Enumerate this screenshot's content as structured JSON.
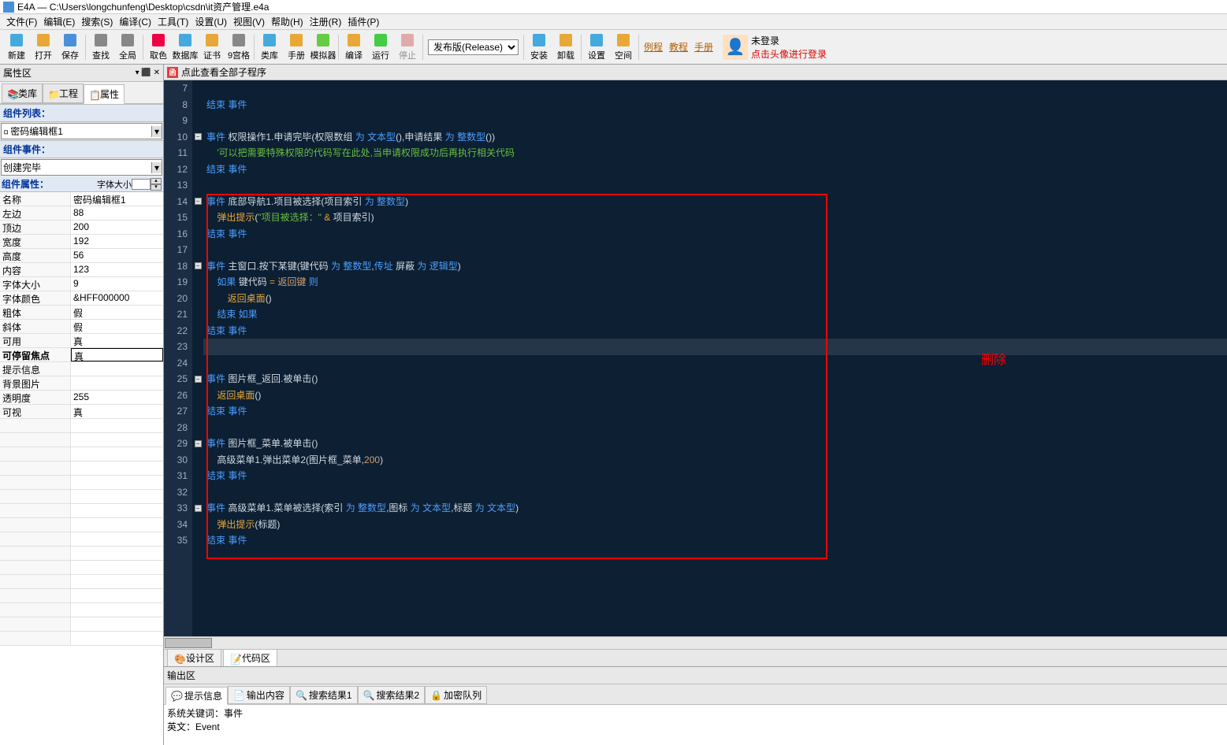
{
  "title": "E4A — C:\\Users\\longchunfeng\\Desktop\\csdn\\it资产管理.e4a",
  "menu": [
    "文件(F)",
    "编辑(E)",
    "搜索(S)",
    "编译(C)",
    "工具(T)",
    "设置(U)",
    "视图(V)",
    "帮助(H)",
    "注册(R)",
    "插件(P)"
  ],
  "toolbar": {
    "groups": [
      [
        "新建",
        "打开",
        "保存"
      ],
      [
        "查找",
        "全局"
      ],
      [
        "取色",
        "数据库",
        "证书",
        "9宫格"
      ],
      [
        "类库",
        "手册",
        "模拟器"
      ],
      [
        "编译",
        "运行",
        "停止"
      ]
    ],
    "release_combo": "发布版(Release)",
    "group2": [
      "安装",
      "卸载"
    ],
    "group3": [
      "设置",
      "空间"
    ],
    "links": [
      "例程",
      "教程",
      "手册"
    ],
    "login_top": "未登录",
    "login_bottom": "点击头像进行登录"
  },
  "left": {
    "header": "属性区",
    "tabs": [
      {
        "label": "类库",
        "active": false
      },
      {
        "label": "工程",
        "active": false
      },
      {
        "label": "属性",
        "active": true
      }
    ],
    "comp_list_hdr": "组件列表：",
    "comp_combo": "密码编辑框1",
    "comp_evt_hdr": "组件事件：",
    "evt_combo": "创建完毕",
    "comp_prop_hdr": "组件属性：",
    "font_size_label": "字体大小",
    "font_size_val": "",
    "props": [
      {
        "name": "名称",
        "val": "密码编辑框1",
        "sel": false
      },
      {
        "name": "左边",
        "val": "88",
        "sel": false
      },
      {
        "name": "顶边",
        "val": "200",
        "sel": false
      },
      {
        "name": "宽度",
        "val": "192",
        "sel": false
      },
      {
        "name": "高度",
        "val": "56",
        "sel": false
      },
      {
        "name": "内容",
        "val": "123",
        "sel": false
      },
      {
        "name": "字体大小",
        "val": "9",
        "sel": false
      },
      {
        "name": "字体颜色",
        "val": "&HFF000000",
        "sel": false
      },
      {
        "name": "粗体",
        "val": "假",
        "sel": false
      },
      {
        "name": "斜体",
        "val": "假",
        "sel": false
      },
      {
        "name": "可用",
        "val": "真",
        "sel": false
      },
      {
        "name": "可停留焦点",
        "val": "真",
        "sel": true,
        "bold": true
      },
      {
        "name": "提示信息",
        "val": "",
        "sel": false
      },
      {
        "name": "背景图片",
        "val": "",
        "sel": false
      },
      {
        "name": "透明度",
        "val": "255",
        "sel": false
      },
      {
        "name": "可视",
        "val": "真",
        "sel": false
      }
    ]
  },
  "editor": {
    "tab_label": "点此查看全部子程序",
    "delete_label": "删除",
    "lines": [
      {
        "n": 7,
        "fold": "",
        "tokens": []
      },
      {
        "n": 8,
        "fold": "",
        "tokens": [
          {
            "c": "kw",
            "t": "结束 事件"
          }
        ]
      },
      {
        "n": 9,
        "fold": "",
        "tokens": []
      },
      {
        "n": 10,
        "fold": "-",
        "tokens": [
          {
            "c": "kw",
            "t": "事件 "
          },
          {
            "c": "ident",
            "t": "权限操作1.申请完毕"
          },
          {
            "c": "ident",
            "t": "(权限数组 "
          },
          {
            "c": "kw",
            "t": "为 "
          },
          {
            "c": "type",
            "t": "文本型"
          },
          {
            "c": "ident",
            "t": "(),申请结果 "
          },
          {
            "c": "kw",
            "t": "为 "
          },
          {
            "c": "type",
            "t": "整数型"
          },
          {
            "c": "ident",
            "t": "())"
          }
        ]
      },
      {
        "n": 11,
        "fold": "",
        "tokens": [
          {
            "c": "ident",
            "t": "    "
          },
          {
            "c": "comment",
            "t": "'可以把需要特殊权限的代码写在此处,当申请权限成功后再执行相关代码"
          }
        ]
      },
      {
        "n": 12,
        "fold": "",
        "tokens": [
          {
            "c": "kw",
            "t": "结束 事件"
          }
        ]
      },
      {
        "n": 13,
        "fold": "",
        "tokens": []
      },
      {
        "n": 14,
        "fold": "-",
        "tokens": [
          {
            "c": "kw",
            "t": "事件 "
          },
          {
            "c": "ident",
            "t": "底部导航1.项目被选择"
          },
          {
            "c": "ident",
            "t": "(项目索引 "
          },
          {
            "c": "kw",
            "t": "为 "
          },
          {
            "c": "type",
            "t": "整数型"
          },
          {
            "c": "ident",
            "t": ")"
          }
        ]
      },
      {
        "n": 15,
        "fold": "",
        "tokens": [
          {
            "c": "ident",
            "t": "    "
          },
          {
            "c": "func",
            "t": "弹出提示"
          },
          {
            "c": "ident",
            "t": "("
          },
          {
            "c": "str",
            "t": "\"项目被选择：\""
          },
          {
            "c": "ident",
            "t": " "
          },
          {
            "c": "const",
            "t": "&"
          },
          {
            "c": "ident",
            "t": " 项目索引)"
          }
        ]
      },
      {
        "n": 16,
        "fold": "",
        "tokens": [
          {
            "c": "kw",
            "t": "结束 事件"
          }
        ]
      },
      {
        "n": 17,
        "fold": "",
        "tokens": []
      },
      {
        "n": 18,
        "fold": "-",
        "tokens": [
          {
            "c": "kw",
            "t": "事件 "
          },
          {
            "c": "ident",
            "t": "主窗口.按下某键"
          },
          {
            "c": "ident",
            "t": "(键代码 "
          },
          {
            "c": "kw",
            "t": "为 "
          },
          {
            "c": "type",
            "t": "整数型"
          },
          {
            "c": "ident",
            "t": ","
          },
          {
            "c": "kw",
            "t": "传址 "
          },
          {
            "c": "ident",
            "t": "屏蔽 "
          },
          {
            "c": "kw",
            "t": "为 "
          },
          {
            "c": "type",
            "t": "逻辑型"
          },
          {
            "c": "ident",
            "t": ")"
          }
        ]
      },
      {
        "n": 19,
        "fold": "",
        "tokens": [
          {
            "c": "ident",
            "t": "    "
          },
          {
            "c": "kw",
            "t": "如果 "
          },
          {
            "c": "ident",
            "t": "键代码 "
          },
          {
            "c": "const",
            "t": "="
          },
          {
            "c": "ident",
            "t": " "
          },
          {
            "c": "num",
            "t": "返回键"
          },
          {
            "c": "ident",
            "t": " "
          },
          {
            "c": "kw",
            "t": "则"
          }
        ]
      },
      {
        "n": 20,
        "fold": "",
        "tokens": [
          {
            "c": "ident",
            "t": "        "
          },
          {
            "c": "func",
            "t": "返回桌面"
          },
          {
            "c": "ident",
            "t": "()"
          }
        ]
      },
      {
        "n": 21,
        "fold": "",
        "tokens": [
          {
            "c": "ident",
            "t": "    "
          },
          {
            "c": "kw",
            "t": "结束 如果"
          }
        ]
      },
      {
        "n": 22,
        "fold": "",
        "tokens": [
          {
            "c": "kw",
            "t": "结束 事件"
          }
        ]
      },
      {
        "n": 23,
        "fold": "",
        "hl": true,
        "tokens": []
      },
      {
        "n": 24,
        "fold": "",
        "tokens": []
      },
      {
        "n": 25,
        "fold": "-",
        "tokens": [
          {
            "c": "kw",
            "t": "事件 "
          },
          {
            "c": "ident",
            "t": "图片框_返回.被单击"
          },
          {
            "c": "ident",
            "t": "()"
          }
        ]
      },
      {
        "n": 26,
        "fold": "",
        "tokens": [
          {
            "c": "ident",
            "t": "    "
          },
          {
            "c": "func",
            "t": "返回桌面"
          },
          {
            "c": "ident",
            "t": "()"
          }
        ]
      },
      {
        "n": 27,
        "fold": "",
        "tokens": [
          {
            "c": "kw",
            "t": "结束 事件"
          }
        ]
      },
      {
        "n": 28,
        "fold": "",
        "tokens": []
      },
      {
        "n": 29,
        "fold": "-",
        "tokens": [
          {
            "c": "kw",
            "t": "事件 "
          },
          {
            "c": "ident",
            "t": "图片框_菜单.被单击"
          },
          {
            "c": "ident",
            "t": "()"
          }
        ]
      },
      {
        "n": 30,
        "fold": "",
        "tokens": [
          {
            "c": "ident",
            "t": "    高级菜单1.弹出菜单2(图片框_菜单,"
          },
          {
            "c": "num",
            "t": "200"
          },
          {
            "c": "ident",
            "t": ")"
          }
        ]
      },
      {
        "n": 31,
        "fold": "",
        "tokens": [
          {
            "c": "kw",
            "t": "结束 事件"
          }
        ]
      },
      {
        "n": 32,
        "fold": "",
        "tokens": []
      },
      {
        "n": 33,
        "fold": "-",
        "tokens": [
          {
            "c": "kw",
            "t": "事件 "
          },
          {
            "c": "ident",
            "t": "高级菜单1.菜单被选择"
          },
          {
            "c": "ident",
            "t": "(索引 "
          },
          {
            "c": "kw",
            "t": "为 "
          },
          {
            "c": "type",
            "t": "整数型"
          },
          {
            "c": "ident",
            "t": ",图标 "
          },
          {
            "c": "kw",
            "t": "为 "
          },
          {
            "c": "type",
            "t": "文本型"
          },
          {
            "c": "ident",
            "t": ",标题 "
          },
          {
            "c": "kw",
            "t": "为 "
          },
          {
            "c": "type",
            "t": "文本型"
          },
          {
            "c": "ident",
            "t": ")"
          }
        ]
      },
      {
        "n": 34,
        "fold": "",
        "tokens": [
          {
            "c": "ident",
            "t": "    "
          },
          {
            "c": "func",
            "t": "弹出提示"
          },
          {
            "c": "ident",
            "t": "(标题)"
          }
        ]
      },
      {
        "n": 35,
        "fold": "",
        "tokens": [
          {
            "c": "kw",
            "t": "结束 事件"
          }
        ]
      }
    ]
  },
  "bottom_tabs": [
    {
      "label": "设计区",
      "active": false
    },
    {
      "label": "代码区",
      "active": true
    }
  ],
  "output": {
    "header": "输出区",
    "tabs": [
      {
        "label": "提示信息",
        "active": true
      },
      {
        "label": "输出内容",
        "active": false
      },
      {
        "label": "搜索结果1",
        "active": false
      },
      {
        "label": "搜索结果2",
        "active": false
      },
      {
        "label": "加密队列",
        "active": false
      }
    ],
    "line1": "系统关键词：事件",
    "line2": "英文：Event"
  }
}
